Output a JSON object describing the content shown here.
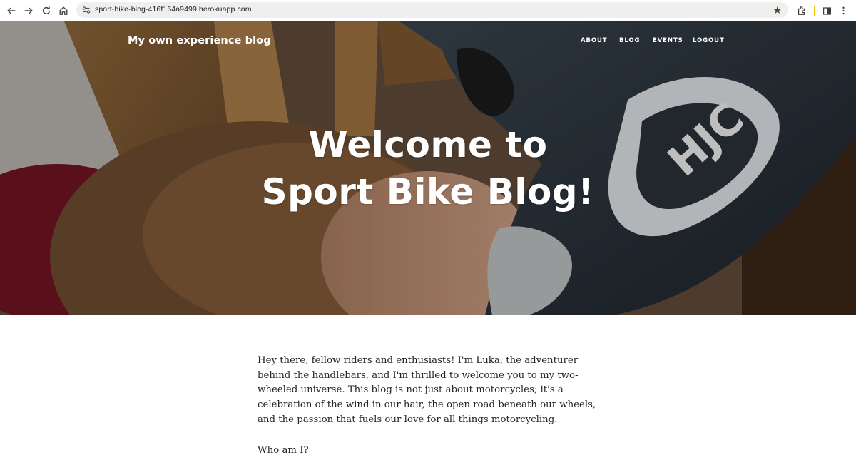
{
  "browser": {
    "url": "sport-bike-blog-416f164a9499.herokuapp.com",
    "icons": [
      "back-icon",
      "forward-icon",
      "reload-icon",
      "home-icon",
      "site-info-icon",
      "bookmark-star-icon",
      "extensions-icon",
      "side-panel-icon",
      "menu-kebab-icon"
    ]
  },
  "site": {
    "brand": "My own experience blog",
    "nav": [
      {
        "label": "ABOUT"
      },
      {
        "label": "BLOG"
      },
      {
        "label": "EVENTS"
      },
      {
        "label": "LOGOUT"
      }
    ]
  },
  "hero": {
    "title_line1": "Welcome to",
    "title_line2": "Sport Bike Blog!",
    "helmet_brand": "HJC"
  },
  "content": {
    "intro": "Hey there, fellow riders and enthusiasts! I'm Luka, the adventurer behind the handlebars, and I'm thrilled to welcome you to my two-wheeled universe. This blog is not just about motorcycles; it's a celebration of the wind in our hair, the open road beneath our wheels, and the passion that fuels our love for all things motorcycling.",
    "heading": "Who am I?"
  },
  "colors": {
    "chrome_bg": "#ffffff",
    "omnibox_bg": "#efefef",
    "hero_text": "#ffffff",
    "body_text": "#212529"
  }
}
